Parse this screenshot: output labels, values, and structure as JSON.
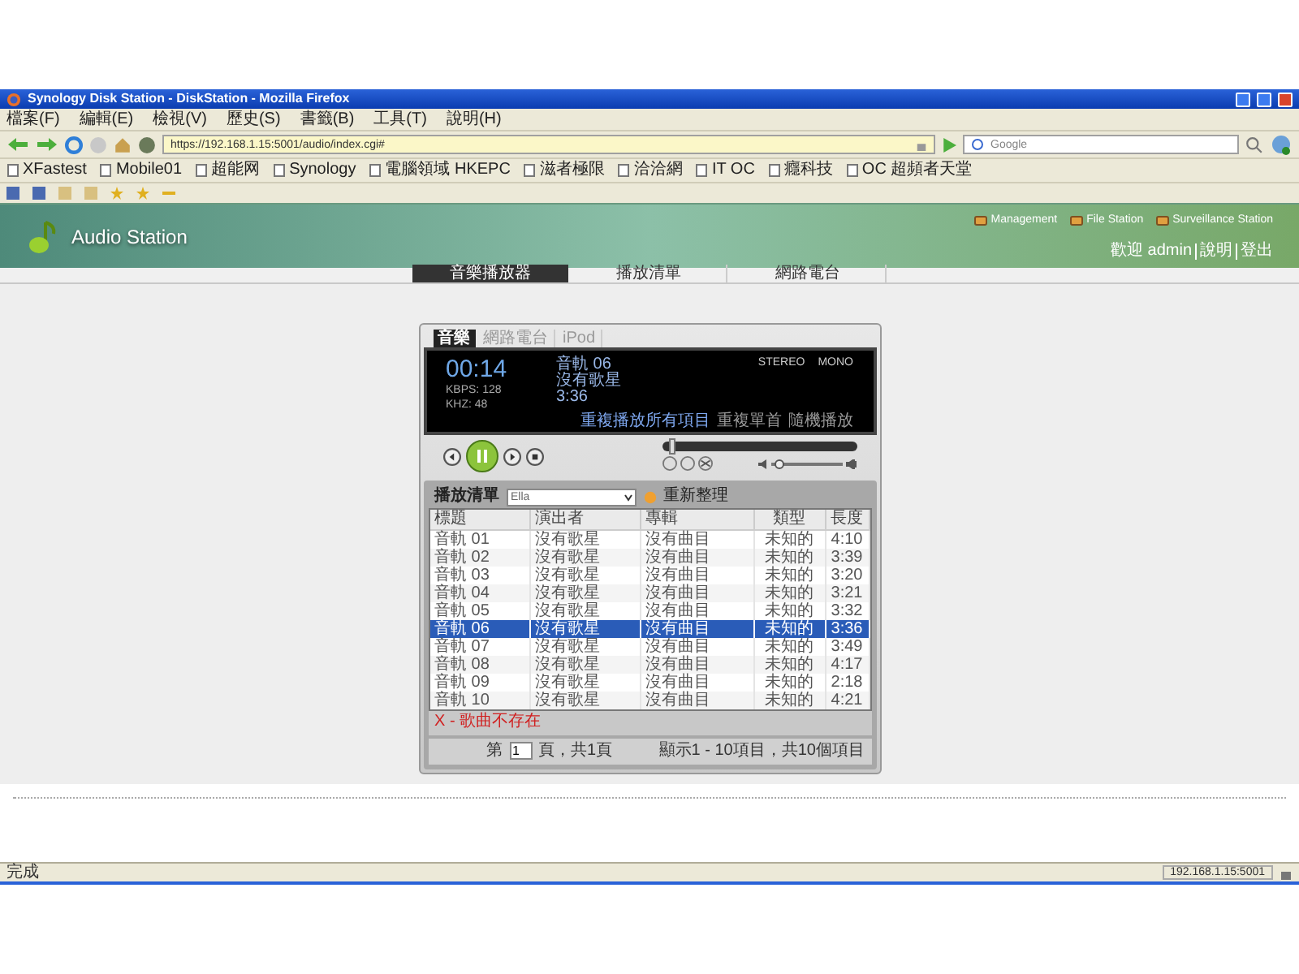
{
  "window": {
    "title": "Synology Disk Station - DiskStation - Mozilla Firefox"
  },
  "menu": [
    "檔案(F)",
    "編輯(E)",
    "檢視(V)",
    "歷史(S)",
    "書籤(B)",
    "工具(T)",
    "說明(H)"
  ],
  "address_bar": {
    "url": "https://192.168.1.15:5001/audio/index.cgi#"
  },
  "search": {
    "placeholder": "Google"
  },
  "bookmarks": [
    "XFastest",
    "Mobile01",
    "超能网",
    "Synology",
    "電腦領域 HKEPC",
    "滋者極限",
    "洽洽網",
    "IT OC",
    "癮科技",
    "OC 超頻者天堂"
  ],
  "app": {
    "title": "Audio Station",
    "links": [
      "Management",
      "File Station",
      "Surveillance Station"
    ],
    "user_links": [
      "歡迎 admin",
      "說明",
      "登出"
    ]
  },
  "tabs": [
    {
      "label": "音樂播放器",
      "selected": true
    },
    {
      "label": "播放清單",
      "selected": false
    },
    {
      "label": "網路電台",
      "selected": false
    }
  ],
  "player": {
    "tabs": [
      {
        "label": "音樂",
        "selected": true
      },
      {
        "label": "網路電台",
        "selected": false
      },
      {
        "label": "iPod",
        "selected": false
      }
    ],
    "time": "00:14",
    "kbps": "KBPS: 128",
    "khz": "KHZ: 48",
    "track": [
      "音軌 06",
      "沒有歌星",
      "3:36"
    ],
    "channels": [
      "STEREO",
      "MONO"
    ],
    "repeat_options": [
      {
        "label": "重複播放所有項目",
        "selected": true
      },
      {
        "label": "重複單首",
        "selected": false
      },
      {
        "label": "隨機播放",
        "selected": false
      }
    ],
    "playing": true,
    "seek": {
      "level": 0.05
    },
    "volume": {
      "level": 0.12
    }
  },
  "playlist": {
    "label": "播放清單",
    "value": "Ella",
    "refresh": "重新整理",
    "columns": [
      "標題",
      "演出者",
      "專輯",
      "類型",
      "長度"
    ],
    "rows": [
      {
        "cells": [
          "音軌 01",
          "沒有歌星",
          "沒有曲目",
          "未知的",
          "4:10"
        ],
        "selected": false
      },
      {
        "cells": [
          "音軌 02",
          "沒有歌星",
          "沒有曲目",
          "未知的",
          "3:39"
        ],
        "selected": false
      },
      {
        "cells": [
          "音軌 03",
          "沒有歌星",
          "沒有曲目",
          "未知的",
          "3:20"
        ],
        "selected": false
      },
      {
        "cells": [
          "音軌 04",
          "沒有歌星",
          "沒有曲目",
          "未知的",
          "3:21"
        ],
        "selected": false
      },
      {
        "cells": [
          "音軌 05",
          "沒有歌星",
          "沒有曲目",
          "未知的",
          "3:32"
        ],
        "selected": false
      },
      {
        "cells": [
          "音軌 06",
          "沒有歌星",
          "沒有曲目",
          "未知的",
          "3:36"
        ],
        "selected": true
      },
      {
        "cells": [
          "音軌 07",
          "沒有歌星",
          "沒有曲目",
          "未知的",
          "3:49"
        ],
        "selected": false
      },
      {
        "cells": [
          "音軌 08",
          "沒有歌星",
          "沒有曲目",
          "未知的",
          "4:17"
        ],
        "selected": false
      },
      {
        "cells": [
          "音軌 09",
          "沒有歌星",
          "沒有曲目",
          "未知的",
          "2:18"
        ],
        "selected": false
      },
      {
        "cells": [
          "音軌 10",
          "沒有歌星",
          "沒有曲目",
          "未知的",
          "4:21"
        ],
        "selected": false
      }
    ],
    "note": "X - 歌曲不存在",
    "pager": {
      "prefix": "第",
      "page": "1",
      "suffix": "頁，共1頁",
      "summary": "顯示1 - 10項目，共10個項目"
    }
  },
  "status_bar": {
    "text": "完成",
    "host": "192.168.1.15:5001"
  }
}
